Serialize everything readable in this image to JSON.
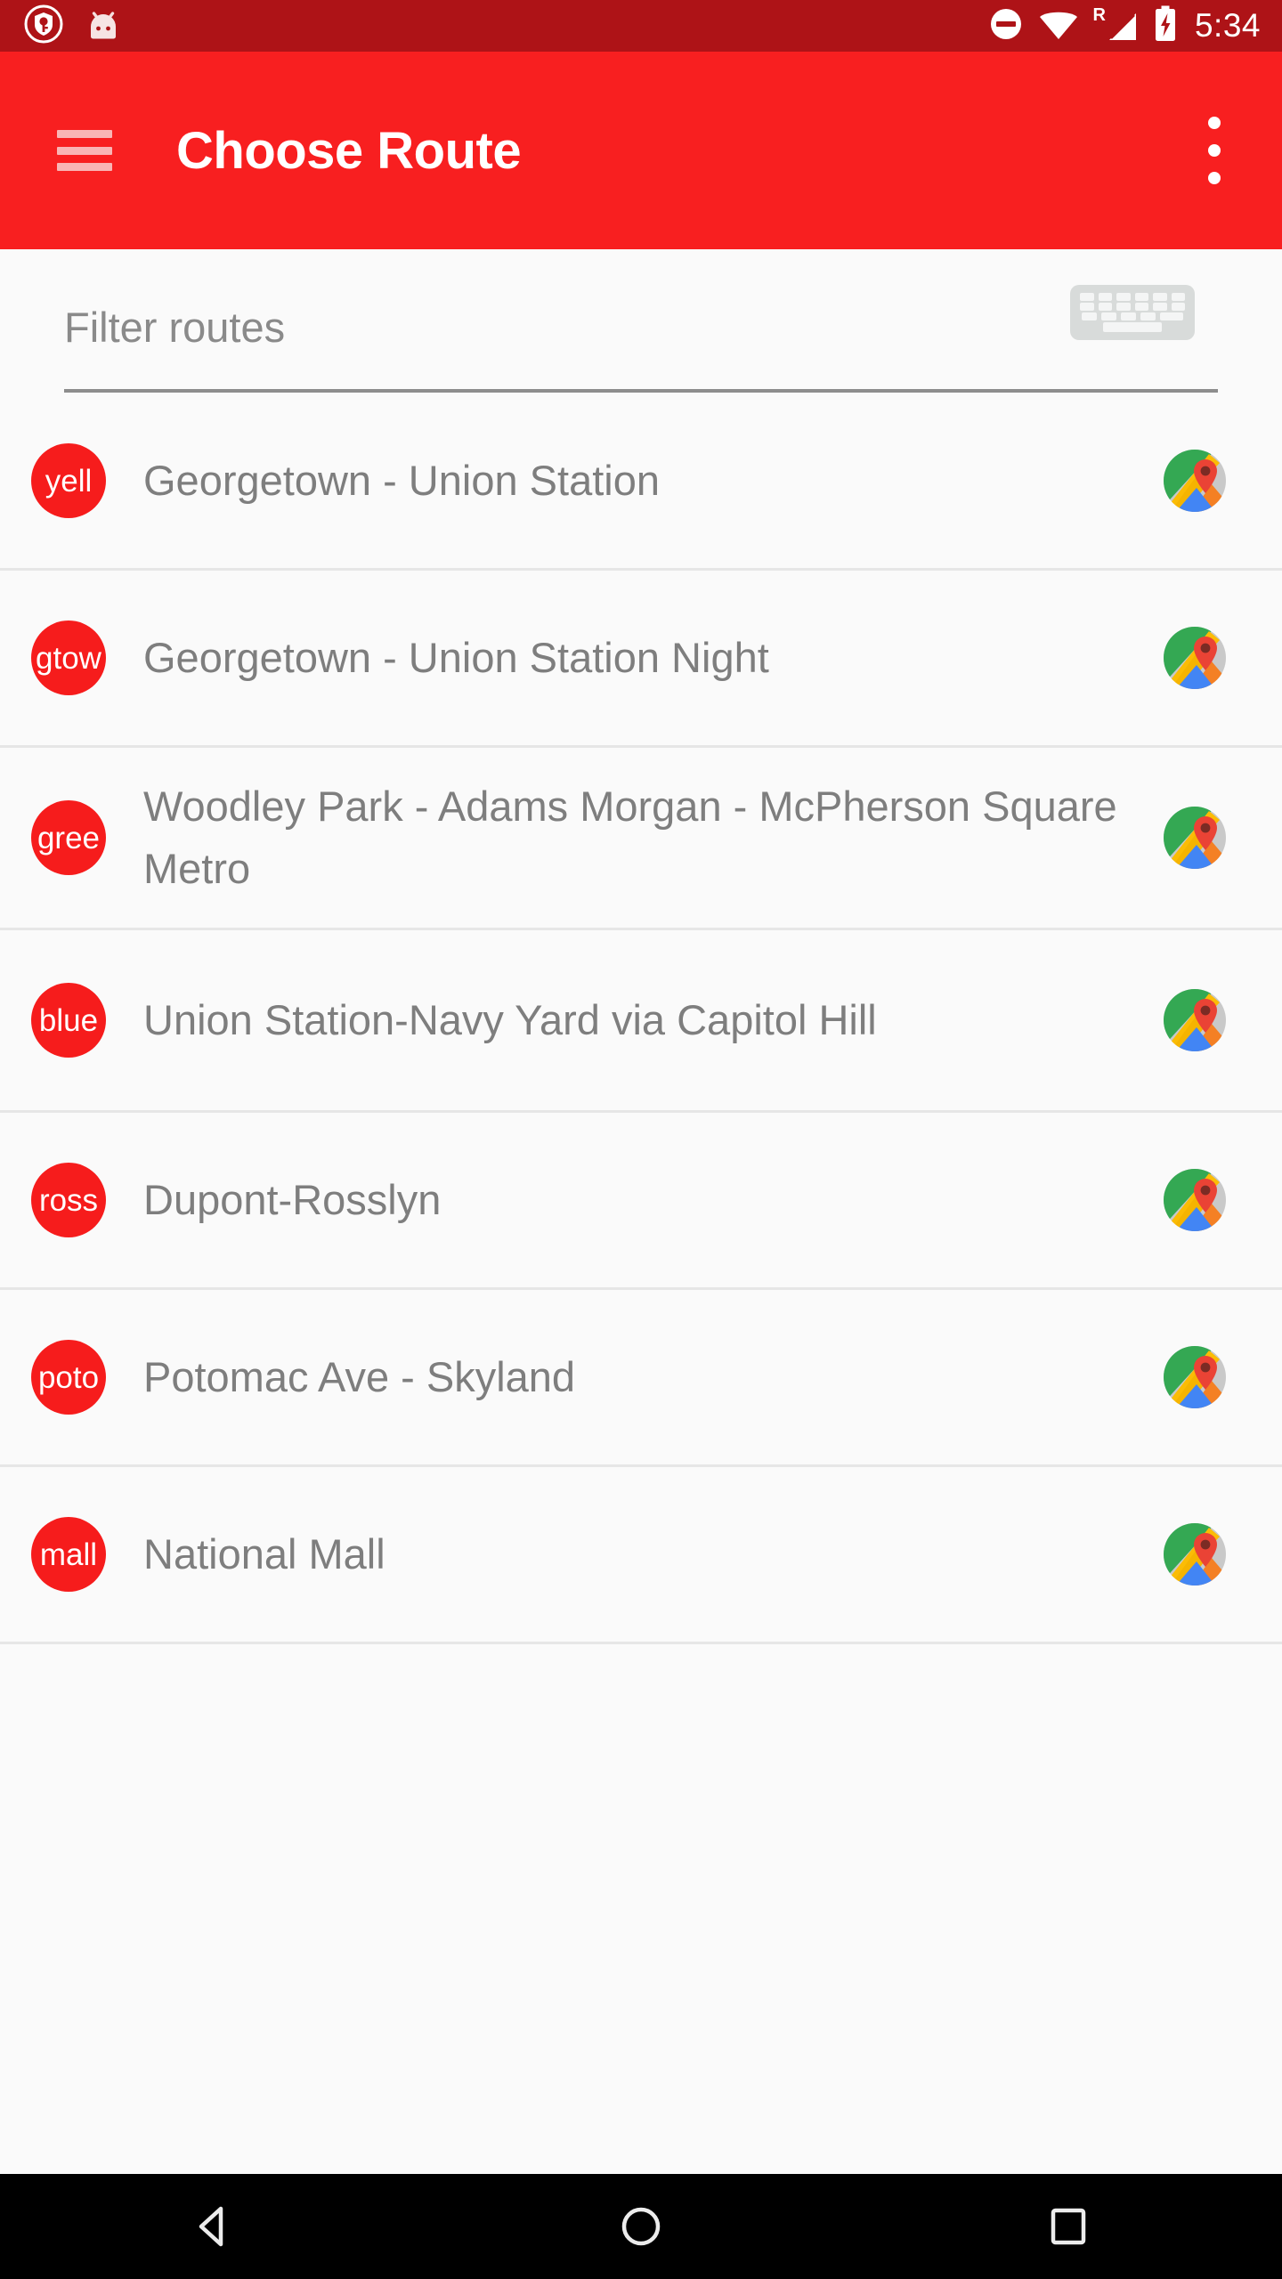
{
  "status_bar": {
    "background_color": "#ae1317",
    "clock": "5:34",
    "roaming_label": "R",
    "left_icons": [
      "vpn-key-shield-icon",
      "android-head-icon"
    ],
    "right_icons": [
      "do-not-disturb-icon",
      "wifi-icon",
      "cell-signal-icon",
      "battery-charging-icon"
    ]
  },
  "app_bar": {
    "background_color": "#f81f20",
    "title": "Choose Route",
    "menu_icon": "hamburger-menu-icon",
    "overflow_icon": "more-vertical-icon"
  },
  "search": {
    "placeholder": "Filter routes",
    "value": "",
    "keyboard_icon": "keyboard-icon"
  },
  "routes": [
    {
      "tag": "yell",
      "name": "Georgetown - Union Station",
      "tag_color": "#f61c1c",
      "map_icon": "google-maps-icon"
    },
    {
      "tag": "gtow",
      "name": "Georgetown - Union Station Night",
      "tag_color": "#f61c1c",
      "map_icon": "google-maps-icon"
    },
    {
      "tag": "gree",
      "name": "Woodley Park - Adams Morgan - McPherson Square Metro",
      "tag_color": "#f61c1c",
      "map_icon": "google-maps-icon"
    },
    {
      "tag": "blue",
      "name": "Union Station-Navy Yard via Capitol Hill",
      "tag_color": "#f61c1c",
      "map_icon": "google-maps-icon"
    },
    {
      "tag": "ross",
      "name": "Dupont-Rosslyn",
      "tag_color": "#f61c1c",
      "map_icon": "google-maps-icon"
    },
    {
      "tag": "poto",
      "name": "Potomac Ave - Skyland",
      "tag_color": "#f61c1c",
      "map_icon": "google-maps-icon"
    },
    {
      "tag": "mall",
      "name": "National Mall",
      "tag_color": "#f61c1c",
      "map_icon": "google-maps-icon"
    }
  ],
  "nav_bar": {
    "background_color": "#000000",
    "buttons": [
      "back-button",
      "home-button",
      "recents-button"
    ]
  },
  "colors": {
    "page_background": "#fafafa",
    "divider": "#e6e6e6",
    "primary_text": "#7e7e7e",
    "placeholder_text": "#8a8a8a"
  }
}
